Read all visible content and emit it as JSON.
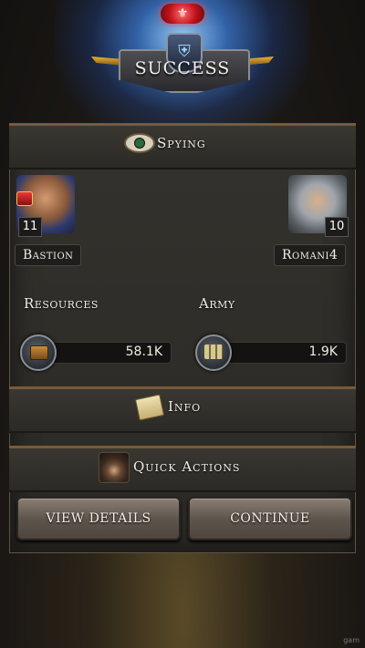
{
  "banner": {
    "title": "SUCCESS",
    "gem_symbol": "⚜"
  },
  "spying_section": {
    "title": "Spying"
  },
  "attacker": {
    "name": "Bastion",
    "level": "11"
  },
  "target": {
    "name": "Romani4",
    "level": "10"
  },
  "resources": {
    "label": "Resources",
    "value": "58.1K",
    "icon": "chest-icon"
  },
  "army": {
    "label": "Army",
    "value": "1.9K",
    "icon": "soldiers-icon"
  },
  "info_section": {
    "title": "Info",
    "icon": "scroll-icon"
  },
  "quick_actions": {
    "title": "Quick Actions",
    "icon": "hooded-spy-icon"
  },
  "buttons": {
    "view_details": "VIEW DETAILS",
    "continue": "CONTINUE"
  },
  "corner_note": "gam"
}
